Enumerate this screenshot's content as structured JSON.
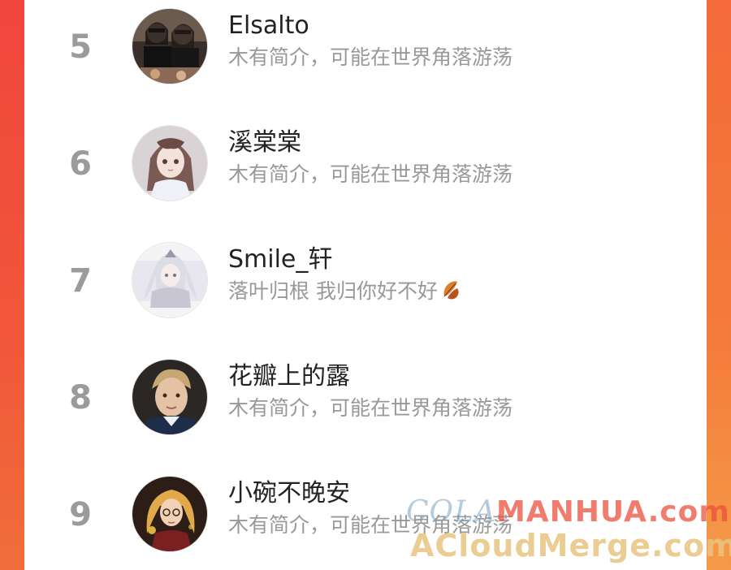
{
  "rows": [
    {
      "rank": "5",
      "name": "Elsalto",
      "bio": "木有简介，可能在世界角落游荡",
      "avatar": "group-photo-avatar"
    },
    {
      "rank": "6",
      "name": "溪棠棠",
      "bio": "木有简介，可能在世界角落游荡",
      "avatar": "anime-girl-avatar"
    },
    {
      "rank": "7",
      "name": "Smile_轩",
      "bio": "落叶归根 我归你好不好",
      "avatar": "white-hair-anime-avatar",
      "bio_emoji": "fallen-leaf-icon"
    },
    {
      "rank": "8",
      "name": "花瓣上的露",
      "bio": "木有简介，可能在世界角落游荡",
      "avatar": "young-man-photo-avatar"
    },
    {
      "rank": "9",
      "name": "小碗不晚安",
      "bio": "木有简介，可能在世界角落游荡",
      "avatar": "golden-hair-illustration-avatar"
    }
  ],
  "watermark": {
    "line1_a": "COLA",
    "line1_b": "MANHUA",
    "line1_c": ".com",
    "line2": "ACloudMerge.com"
  },
  "colors": {
    "background_accent": "#f2613a",
    "rank_text": "#9b9b9b",
    "name_text": "#222222",
    "bio_text": "#999999"
  }
}
